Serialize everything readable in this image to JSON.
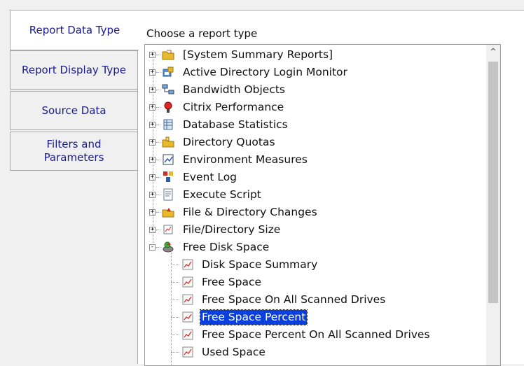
{
  "tabs": [
    {
      "label": "Report Data Type",
      "active": true
    },
    {
      "label": "Report Display Type",
      "active": false
    },
    {
      "label": "Source Data",
      "active": false
    },
    {
      "label": "Filters and Parameters",
      "active": false
    }
  ],
  "panel": {
    "title": "Choose a report type"
  },
  "tree": {
    "items": [
      {
        "label": "[System Summary Reports]",
        "icon": "folder-icon",
        "expanded": false
      },
      {
        "label": "Active Directory Login Monitor",
        "icon": "active-directory-icon",
        "expanded": false
      },
      {
        "label": "Bandwidth Objects",
        "icon": "network-icon",
        "expanded": false
      },
      {
        "label": "Citrix Performance",
        "icon": "citrix-icon",
        "expanded": false
      },
      {
        "label": "Database Statistics",
        "icon": "database-icon",
        "expanded": false
      },
      {
        "label": "Directory Quotas",
        "icon": "folder-quota-icon",
        "expanded": false
      },
      {
        "label": "Environment Measures",
        "icon": "environment-icon",
        "expanded": false
      },
      {
        "label": "Event Log",
        "icon": "event-log-icon",
        "expanded": false
      },
      {
        "label": "Execute Script",
        "icon": "script-icon",
        "expanded": false
      },
      {
        "label": "File & Directory Changes",
        "icon": "folder-change-icon",
        "expanded": false
      },
      {
        "label": "File/Directory Size",
        "icon": "file-size-icon",
        "expanded": false
      },
      {
        "label": "Free Disk Space",
        "icon": "disk-icon",
        "expanded": true
      },
      {
        "label": "Disk Space Summary",
        "icon": "report-icon",
        "child": true
      },
      {
        "label": "Free Space",
        "icon": "report-icon",
        "child": true
      },
      {
        "label": "Free Space On All Scanned Drives",
        "icon": "report-icon",
        "child": true
      },
      {
        "label": "Free Space Percent",
        "icon": "report-icon",
        "child": true,
        "selected": true
      },
      {
        "label": "Free Space Percent On All Scanned Drives",
        "icon": "report-icon",
        "child": true
      },
      {
        "label": "Used Space",
        "icon": "report-icon",
        "child": true
      }
    ]
  },
  "colors": {
    "tab_text": "#1a1a8c",
    "selection": "#0a3fdb"
  }
}
